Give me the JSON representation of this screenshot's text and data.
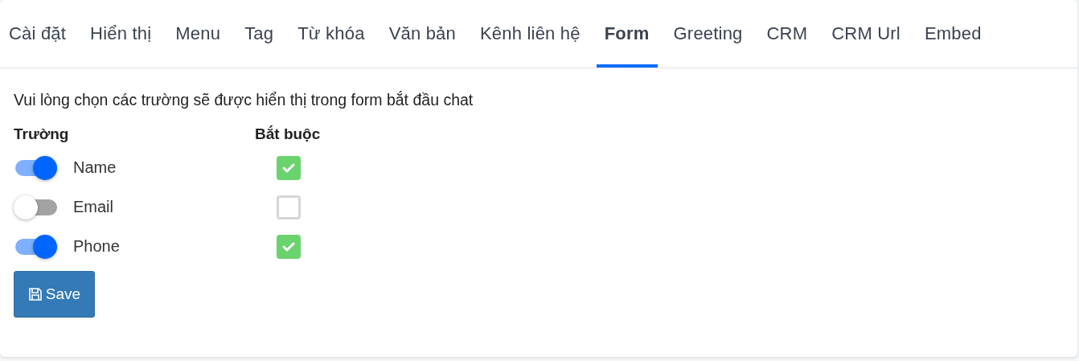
{
  "tabs": [
    {
      "label": "Cài đặt",
      "selected": false
    },
    {
      "label": "Hiển thị",
      "selected": false
    },
    {
      "label": "Menu",
      "selected": false
    },
    {
      "label": "Tag",
      "selected": false
    },
    {
      "label": "Từ khóa",
      "selected": false
    },
    {
      "label": "Văn bản",
      "selected": false
    },
    {
      "label": "Kênh liên hệ",
      "selected": false
    },
    {
      "label": "Form",
      "selected": true
    },
    {
      "label": "Greeting",
      "selected": false
    },
    {
      "label": "CRM",
      "selected": false
    },
    {
      "label": "CRM Url",
      "selected": false
    },
    {
      "label": "Embed",
      "selected": false
    }
  ],
  "intro": "Vui lòng chọn các trường sẽ được hiển thị trong form bắt đầu chat",
  "columns": [
    "Trường",
    "Bắt buộc"
  ],
  "fields": [
    {
      "label": "Name",
      "on": true,
      "required": true
    },
    {
      "label": "Email",
      "on": false,
      "required": false
    },
    {
      "label": "Phone",
      "on": true,
      "required": true
    }
  ],
  "save_button": "Save"
}
